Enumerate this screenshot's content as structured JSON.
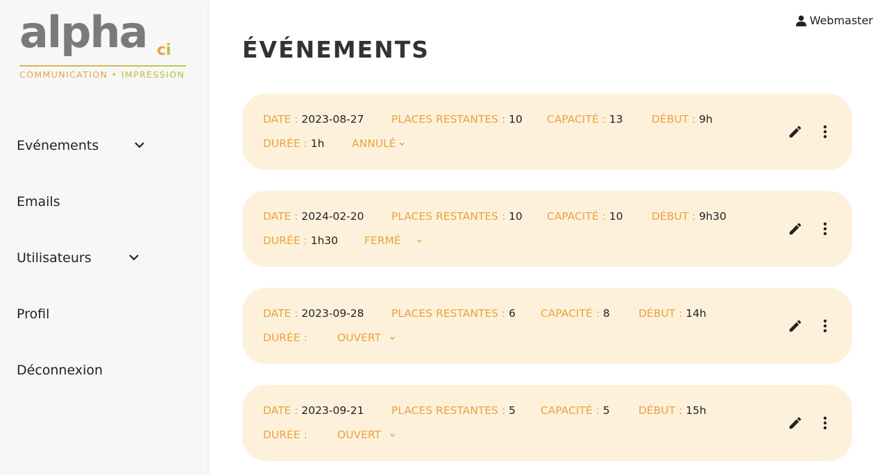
{
  "brand": {
    "word": "alpha",
    "ci_c": "c",
    "ci_i": "i",
    "sub_left": "COMMUNICATION",
    "sub_dot": "•",
    "sub_right": "IMPRESSION"
  },
  "user": {
    "name": "Webmaster",
    "icon": "user-icon"
  },
  "page": {
    "title": "ÉVÉNEMENTS"
  },
  "nav": {
    "items": [
      {
        "label": "Evénements",
        "has_chevron": true
      },
      {
        "label": "Emails",
        "has_chevron": false
      },
      {
        "label": "Utilisateurs",
        "has_chevron": true
      },
      {
        "label": "Profil",
        "has_chevron": false
      },
      {
        "label": "Déconnexion",
        "has_chevron": false
      }
    ]
  },
  "labels": {
    "date": "DATE :",
    "places": "PLACES RESTANTES :",
    "capacite": "CAPACITÉ :",
    "debut": "DÉBUT :",
    "duree": "DURÉE :"
  },
  "events": [
    {
      "date": "2023-08-27",
      "places": "10",
      "capacite": "13",
      "debut": "9h",
      "duree": "1h",
      "status": "ANNULÉ"
    },
    {
      "date": "2024-02-20",
      "places": "10",
      "capacite": "10",
      "debut": "9h30",
      "duree": "1h30",
      "status": "FERMÉ"
    },
    {
      "date": "2023-09-28",
      "places": "6",
      "capacite": "8",
      "debut": "14h",
      "duree": "",
      "status": "OUVERT"
    },
    {
      "date": "2023-09-21",
      "places": "5",
      "capacite": "5",
      "debut": "15h",
      "duree": "",
      "status": "OUVERT"
    }
  ],
  "colors": {
    "accent": "#e8a33d",
    "card_bg": "#fef1dc",
    "sidebar_bg": "#f7f7f7",
    "green": "#b5c33a"
  }
}
